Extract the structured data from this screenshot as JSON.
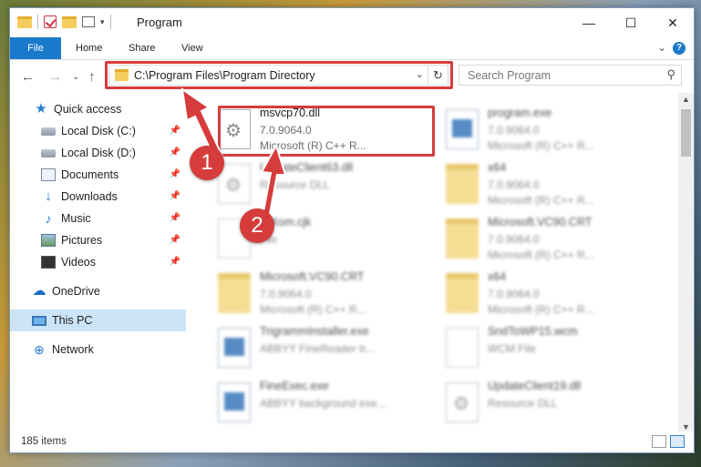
{
  "window": {
    "title": "Program",
    "controls": {
      "minimize": "—",
      "maximize": "☐",
      "close": "✕"
    }
  },
  "ribbon": {
    "tabs": [
      "File",
      "Home",
      "Share",
      "View"
    ],
    "expand_glyph": "⌄",
    "help_glyph": "?"
  },
  "nav": {
    "back_glyph": "←",
    "forward_glyph": "→",
    "recent_glyph": "⌄",
    "up_glyph": "↑",
    "address_path": "C:\\Program Files\\Program Directory",
    "address_dropdown_glyph": "⌄",
    "refresh_glyph": "↻",
    "search_placeholder": "Search Program",
    "search_glyph": "⚲"
  },
  "sidebar": {
    "items": [
      {
        "label": "Quick access",
        "icon": "star-icon",
        "glyph": "★",
        "pinned": false
      },
      {
        "label": "Local Disk (C:)",
        "icon": "disk-icon",
        "pinned": true
      },
      {
        "label": "Local Disk (D:)",
        "icon": "disk-icon",
        "pinned": true
      },
      {
        "label": "Documents",
        "icon": "documents-icon",
        "pinned": true
      },
      {
        "label": "Downloads",
        "icon": "download-icon",
        "glyph": "↓",
        "pinned": true
      },
      {
        "label": "Music",
        "icon": "music-icon",
        "glyph": "♪",
        "pinned": true
      },
      {
        "label": "Pictures",
        "icon": "pictures-icon",
        "pinned": true
      },
      {
        "label": "Videos",
        "icon": "videos-icon",
        "pinned": true
      },
      {
        "label": "OneDrive",
        "icon": "cloud-icon",
        "glyph": "☁",
        "pinned": false
      },
      {
        "label": "This PC",
        "icon": "computer-icon",
        "pinned": false,
        "selected": true
      },
      {
        "label": "Network",
        "icon": "network-icon",
        "glyph": "⊕",
        "pinned": false
      }
    ],
    "pin_glyph": "📌"
  },
  "files": [
    {
      "name": "msvcp70.dll",
      "line2": "7.0.9064.0",
      "line3": "Microsoft (R) C++ R...",
      "type": "dll",
      "highlighted": true
    },
    {
      "name": "program.exe",
      "line2": "7.0.9064.0",
      "line3": "Microsoft (R) C++ R...",
      "type": "exe"
    },
    {
      "name": "UpdateClient63.dll",
      "line2": "Resource DLL",
      "line3": "",
      "type": "dll"
    },
    {
      "name": "x64",
      "line2": "7.0.9064.0",
      "line3": "Microsoft (R) C++ R...",
      "type": "folder"
    },
    {
      "name": "WXom.cjk",
      "line2": "File",
      "line3": "",
      "type": "doc"
    },
    {
      "name": "Microsoft.VC90.CRT",
      "line2": "7.0.9064.0",
      "line3": "Microsoft (R) C++ R...",
      "type": "folder"
    },
    {
      "name": "Microsoft.VC90.CRT",
      "line2": "7.0.9064.0",
      "line3": "Microsoft (R) C++ R...",
      "type": "folder"
    },
    {
      "name": "x64",
      "line2": "7.0.9064.0",
      "line3": "Microsoft (R) C++ R...",
      "type": "folder"
    },
    {
      "name": "TrigrammInstaller.exe",
      "line2": "ABBYY FineReader tr...",
      "line3": "",
      "type": "exe"
    },
    {
      "name": "SndToWP15.wcm",
      "line2": "WCM File",
      "line3": "",
      "type": "doc"
    },
    {
      "name": "FineExec.exe",
      "line2": "ABBYY background exe...",
      "line3": "",
      "type": "exe"
    },
    {
      "name": "UpdateClient19.dll",
      "line2": "Resource DLL",
      "line3": "",
      "type": "dll"
    }
  ],
  "status": {
    "item_count": "185 items"
  },
  "callouts": [
    "1",
    "2"
  ],
  "colors": {
    "accent": "#1979ca",
    "highlight": "#d63c3c",
    "selected_bg": "#cce4f7"
  }
}
